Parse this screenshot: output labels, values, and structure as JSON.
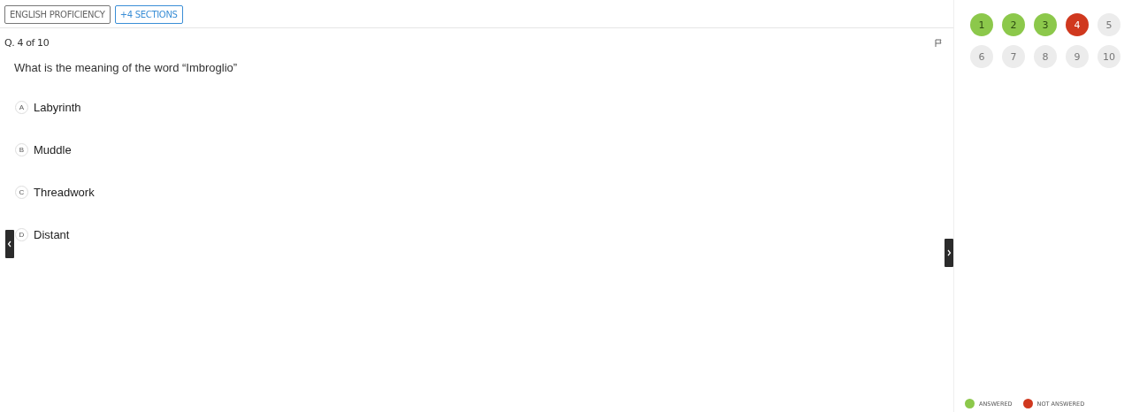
{
  "header": {
    "tags": [
      {
        "label": "ENGLISH PROFICIENCY",
        "kind": "plain"
      },
      {
        "label": "+4 SECTIONS",
        "kind": "link"
      }
    ]
  },
  "question": {
    "counter": "Q. 4 of 10",
    "text": "What is the meaning of the word “Imbroglio”",
    "options": [
      {
        "letter": "A",
        "label": "Labyrinth",
        "selected": false
      },
      {
        "letter": "B",
        "label": "Muddle",
        "selected": false
      },
      {
        "letter": "C",
        "label": "Threadwork",
        "selected": false
      },
      {
        "letter": "D",
        "label": "Distant",
        "selected": false
      }
    ]
  },
  "navigator": {
    "questions": [
      {
        "number": "1",
        "kind": "answered"
      },
      {
        "number": "2",
        "kind": "answered"
      },
      {
        "number": "3",
        "kind": "answered"
      },
      {
        "number": "4",
        "kind": "unanswered"
      },
      {
        "number": "5",
        "kind": "unvisited"
      },
      {
        "number": "6",
        "kind": "unvisited"
      },
      {
        "number": "7",
        "kind": "unvisited"
      },
      {
        "number": "8",
        "kind": "unvisited"
      },
      {
        "number": "9",
        "kind": "unvisited"
      },
      {
        "number": "10",
        "kind": "unvisited"
      }
    ],
    "legend": [
      {
        "label": "ANSWERED",
        "color": "#8cc84b"
      },
      {
        "label": "NOT ANSWERED",
        "color": "#d0381e"
      }
    ]
  }
}
